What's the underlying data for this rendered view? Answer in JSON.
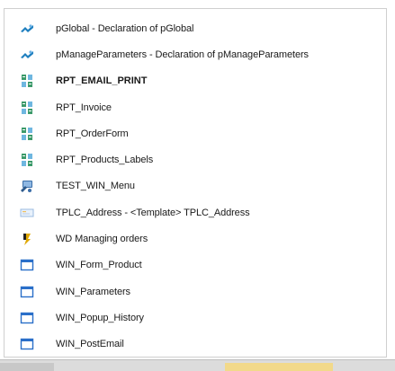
{
  "list": {
    "items": [
      {
        "label": "pGlobal - Declaration of pGlobal",
        "icon": "procedure-icon"
      },
      {
        "label": "pManageParameters - Declaration of pManageParameters",
        "icon": "procedure-icon"
      },
      {
        "label": "RPT_EMAIL_PRINT",
        "icon": "report-icon"
      },
      {
        "label": "RPT_Invoice",
        "icon": "report-icon"
      },
      {
        "label": "RPT_OrderForm",
        "icon": "report-icon"
      },
      {
        "label": "RPT_Products_Labels",
        "icon": "report-icon"
      },
      {
        "label": "TEST_WIN_Menu",
        "icon": "test-icon"
      },
      {
        "label": "TPLC_Address - <Template> TPLC_Address",
        "icon": "template-icon"
      },
      {
        "label": "WD Managing orders",
        "icon": "wizard-icon"
      },
      {
        "label": "WIN_Form_Product",
        "icon": "window-icon"
      },
      {
        "label": "WIN_Parameters",
        "icon": "window-icon"
      },
      {
        "label": "WIN_Popup_History",
        "icon": "window-icon"
      },
      {
        "label": "WIN_PostEmail",
        "icon": "window-icon"
      }
    ]
  },
  "colors": {
    "window_icon": "#2a6fc9",
    "report_icon": "#2e8b57",
    "procedure_icon": "#1f7fbf"
  }
}
